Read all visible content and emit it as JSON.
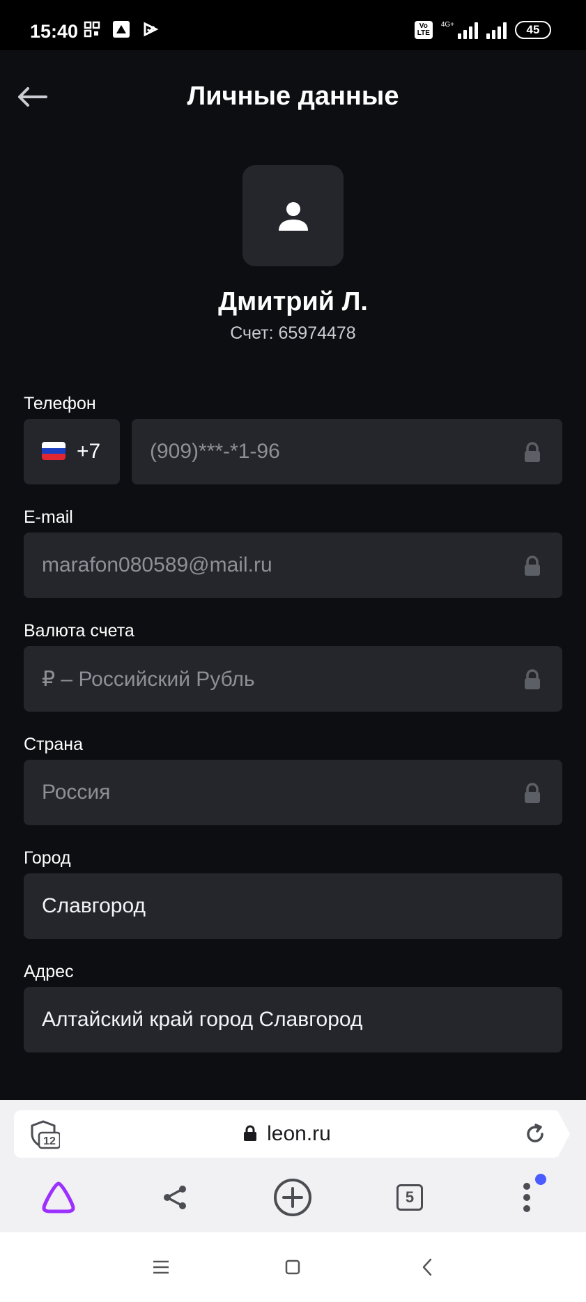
{
  "status_bar": {
    "time": "15:40",
    "network": "4G+",
    "volte": "Vo LTE",
    "battery": "45"
  },
  "header": {
    "title": "Личные данные"
  },
  "profile": {
    "name": "Дмитрий Л.",
    "account": "Счет: 65974478"
  },
  "fields": {
    "phone": {
      "label": "Телефон",
      "country_code": "+7",
      "value": "(909)***-*1-96"
    },
    "email": {
      "label": "E-mail",
      "value": "marafon080589@mail.ru"
    },
    "currency": {
      "label": "Валюта счета",
      "value": "₽ – Российский Рубль"
    },
    "country": {
      "label": "Страна",
      "value": "Россия"
    },
    "city": {
      "label": "Город",
      "value": "Славгород"
    },
    "address": {
      "label": "Адрес",
      "value": "Алтайский край город Славгород"
    }
  },
  "browser": {
    "url": "leon.ru",
    "tracker_count": "12",
    "tabs_count": "5"
  },
  "colors": {
    "background": "#0d0e11",
    "field_bg": "#24262b",
    "alice_purple": "#9b30ff",
    "badge_blue": "#4a5cff"
  }
}
